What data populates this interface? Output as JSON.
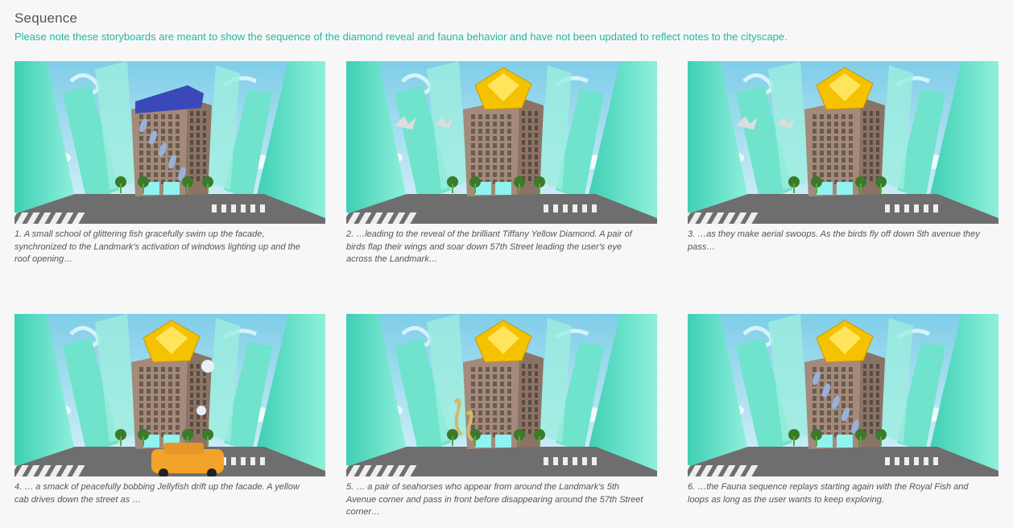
{
  "header": {
    "title": "Sequence",
    "note": "Please note these storyboards are meant to show the sequence of the diamond reveal and fauna behavior and have not been updated to reflect notes to the cityscape."
  },
  "colors": {
    "accent": "#25b7a3",
    "sky": "#9fdcf2",
    "building": "#a38a7a",
    "skyscraper": "#5fe0c6",
    "diamond": "#f4c200",
    "road": "#6e6e6e"
  },
  "storyboards": [
    {
      "caption": "1. A small school of glittering fish gracefully swim up the facade, synchronized to the Landmark's activation of windows lighting up and the roof opening…",
      "diamond": false,
      "birds": false,
      "jellyfish": false,
      "cab": false,
      "seahorses": false,
      "fish": true
    },
    {
      "caption": "2. …leading to the reveal of the brilliant Tiffany Yellow Diamond. A pair of birds flap their wings and soar down 57th Street leading the user's eye across the Landmark…",
      "diamond": true,
      "birds": true,
      "jellyfish": false,
      "cab": false,
      "seahorses": false,
      "fish": false
    },
    {
      "caption": "3. …as they make aerial swoops. As the birds fly off down 5th avenue they pass…",
      "diamond": true,
      "birds": true,
      "jellyfish": false,
      "cab": false,
      "seahorses": false,
      "fish": false
    },
    {
      "caption": "4. … a smack of peacefully bobbing Jellyfish drift up the facade. A yellow cab drives down the street as …",
      "diamond": true,
      "birds": false,
      "jellyfish": true,
      "cab": true,
      "seahorses": false,
      "fish": false
    },
    {
      "caption": "5. … a pair of seahorses who appear from around the Landmark's 5th Avenue corner and pass in front before disappearing around the 57th Street corner…",
      "diamond": true,
      "birds": false,
      "jellyfish": false,
      "cab": false,
      "seahorses": true,
      "fish": false
    },
    {
      "caption": "6. …the Fauna sequence replays starting again with the Royal Fish and loops as long as the user wants to keep exploring.",
      "diamond": true,
      "birds": false,
      "jellyfish": false,
      "cab": false,
      "seahorses": false,
      "fish": true
    }
  ]
}
